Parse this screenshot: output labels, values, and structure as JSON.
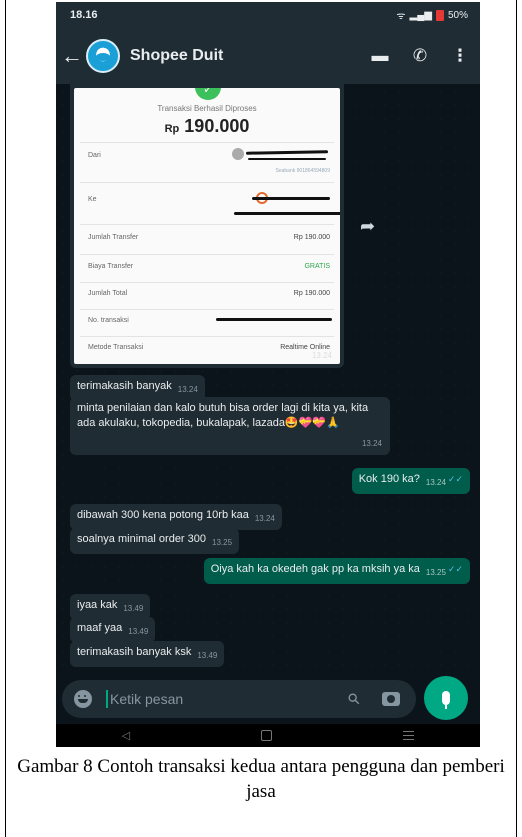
{
  "status_bar": {
    "time": "18.16",
    "battery": "50%"
  },
  "header": {
    "title": "Shopee Duit"
  },
  "receipt": {
    "status": "Transaksi Berhasil Diproses",
    "currency": "Rp",
    "amount": "190.000",
    "rows": [
      {
        "label": "Dari",
        "value": ""
      },
      {
        "label": "Ke",
        "value": ""
      },
      {
        "label": "Jumlah Transfer",
        "value": "Rp 190.000"
      },
      {
        "label": "Biaya Transfer",
        "value": "GRATIS"
      },
      {
        "label": "Jumlah Total",
        "value": "Rp 190.000"
      },
      {
        "label": "No. transaksi",
        "value": ""
      },
      {
        "label": "Metode Transaksi",
        "value": "Realtime Online"
      }
    ],
    "bank_note": "Seabank 901864594809",
    "time": "13.24"
  },
  "messages": [
    {
      "dir": "in",
      "text": "terimakasih banyak",
      "time": "13.24"
    },
    {
      "dir": "in",
      "text": "minta penilaian dan kalo butuh bisa order lagi di kita ya, kita ada akulaku, tokopedia, bukalapak, lazada🤩💝💝🙏",
      "time": "13.24"
    },
    {
      "dir": "out",
      "text": "Kok 190 ka?",
      "time": "13.24"
    },
    {
      "dir": "in",
      "text": "dibawah 300 kena potong 10rb kaa",
      "time": "13.24"
    },
    {
      "dir": "in",
      "text": "soalnya minimal order 300",
      "time": "13.25"
    },
    {
      "dir": "out",
      "text": "Oiya kah ka okedeh gak pp ka mksih ya ka",
      "time": "13.25"
    },
    {
      "dir": "in",
      "text": "iyaa kak",
      "time": "13.49"
    },
    {
      "dir": "in",
      "text": "maaf yaa",
      "time": "13.49"
    },
    {
      "dir": "in",
      "text": "terimakasih banyak ksk",
      "time": "13.49"
    }
  ],
  "input": {
    "placeholder": "Ketik pesan"
  },
  "caption": "Gambar 8 Contoh transaksi kedua antara pengguna dan pemberi jasa",
  "colors": {
    "header": "#1f2c34",
    "chat_bg": "#0b141a",
    "incoming": "#202c33",
    "outgoing": "#005c4b",
    "accent": "#00a884"
  },
  "icons": [
    "back-arrow-icon",
    "store-icon",
    "add-call-icon",
    "more-vert-icon",
    "emoji-icon",
    "attach-icon",
    "camera-icon",
    "mic-icon",
    "forward-icon"
  ]
}
